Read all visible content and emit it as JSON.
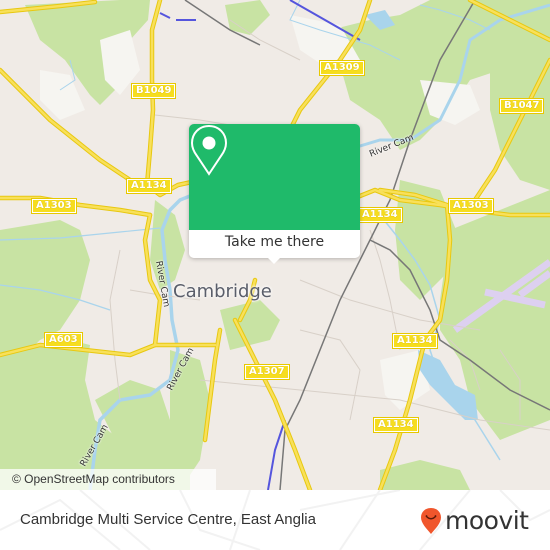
{
  "map": {
    "place_label": "Cambridge",
    "road_labels": [
      {
        "id": "b1049",
        "text": "B1049"
      },
      {
        "id": "a1309",
        "text": "A1309"
      },
      {
        "id": "b1047",
        "text": "B1047"
      },
      {
        "id": "a1134-nw",
        "text": "A1134"
      },
      {
        "id": "a1303-w",
        "text": "A1303"
      },
      {
        "id": "a1134-ne",
        "text": "A1134"
      },
      {
        "id": "a1303-e",
        "text": "A1303"
      },
      {
        "id": "a603",
        "text": "A603"
      },
      {
        "id": "a1134-e",
        "text": "A1134"
      },
      {
        "id": "a1307",
        "text": "A1307"
      },
      {
        "id": "a1134-se",
        "text": "A1134"
      }
    ],
    "river_labels": [
      "River Cam",
      "River Cam",
      "River Cam",
      "River Cam"
    ],
    "attribution": "© OpenStreetMap contributors",
    "colors": {
      "background": "#f0ebe6",
      "park": "#c8e3a3",
      "water": "#a9d4ec",
      "road_major": "#f6dd1f",
      "rail": "#777777",
      "runway": "#ddd0f0"
    }
  },
  "popup": {
    "button_label": "Take me there",
    "icon": "location-pin-icon",
    "color": "#1fba6a"
  },
  "footer": {
    "title": "Cambridge Multi Service Centre, East Anglia",
    "brand": "moovit",
    "brand_color": "#f0562c"
  }
}
